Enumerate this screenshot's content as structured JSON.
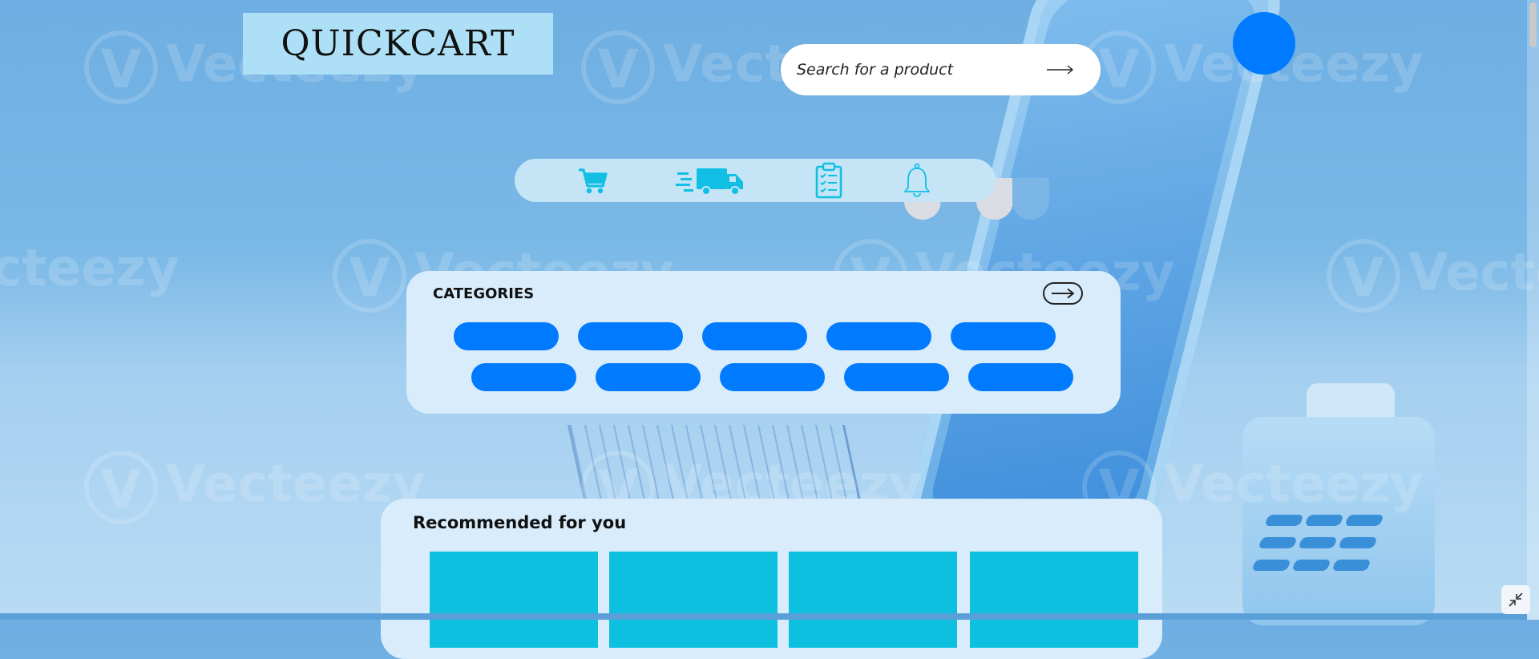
{
  "brand": {
    "logo_text": "QUICKCART"
  },
  "search": {
    "placeholder": "Search for a product",
    "value": "",
    "submit_icon": "arrow-right-icon"
  },
  "avatar": {
    "icon": "user-avatar",
    "color": "#007bff"
  },
  "iconbar": {
    "items": [
      {
        "icon": "cart-icon"
      },
      {
        "icon": "delivery-truck-icon"
      },
      {
        "icon": "clipboard-checklist-icon"
      },
      {
        "icon": "bell-icon"
      }
    ],
    "icon_color": "#10bfe3"
  },
  "categories": {
    "title": "CATEGORIES",
    "more_icon": "arrow-right-icon",
    "pill_color": "#007bff",
    "pills_row1": [
      "",
      "",
      "",
      "",
      ""
    ],
    "pills_row2": [
      "",
      "",
      "",
      "",
      ""
    ]
  },
  "recommended": {
    "title": "Recommended for you",
    "card_color": "#0ec0e0",
    "cards": [
      "",
      "",
      "",
      ""
    ]
  },
  "background": {
    "watermark": "Vecteezy"
  },
  "controls": {
    "collapse_icon": "collapse-icon"
  }
}
